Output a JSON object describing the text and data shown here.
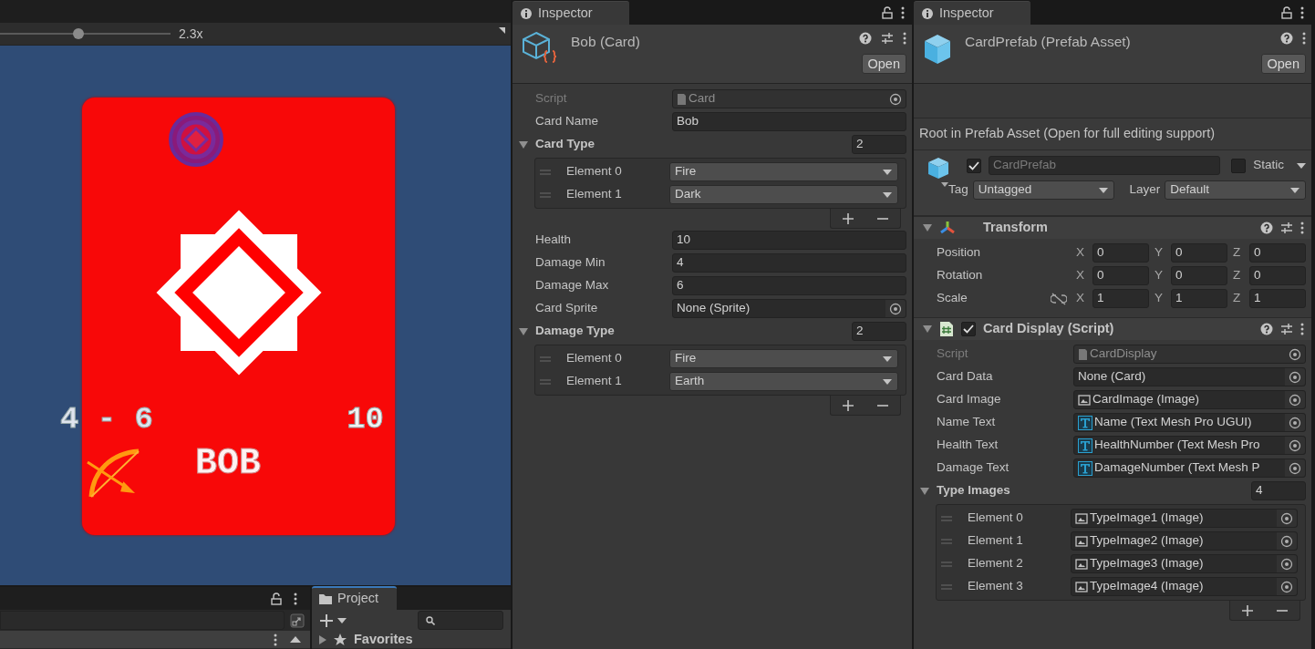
{
  "game_view": {
    "zoom": {
      "level": 0.46,
      "reading": "2.3x"
    },
    "card": {
      "damage": "4 - 6",
      "health": "10",
      "name": "BOB"
    }
  },
  "bottom_panel": {
    "project_tab": {
      "label": "Project",
      "selected": true
    },
    "favorites": {
      "label": "Favorites",
      "expanded": false
    }
  },
  "inspectors": [
    {
      "kind": "asset",
      "tab": {
        "label": "Inspector",
        "selected": true
      },
      "title": "Bob (Card)",
      "open_button": "Open",
      "fields": [
        {
          "kind": "script",
          "label": "Script",
          "value": "Card"
        },
        {
          "kind": "text",
          "label": "Card Name",
          "value": "Bob"
        },
        {
          "kind": "array",
          "label": "Card Type",
          "count": "2",
          "expanded": true,
          "elements": [
            {
              "kind": "enum",
              "label": "Element 0",
              "value": "Fire"
            },
            {
              "kind": "enum",
              "label": "Element 1",
              "value": "Dark"
            }
          ]
        },
        {
          "kind": "text",
          "label": "Health",
          "value": "10"
        },
        {
          "kind": "text",
          "label": "Damage Min",
          "value": "4"
        },
        {
          "kind": "text",
          "label": "Damage Max",
          "value": "6"
        },
        {
          "kind": "object",
          "label": "Card Sprite",
          "value": "None (Sprite)"
        },
        {
          "kind": "array",
          "label": "Damage Type",
          "count": "2",
          "expanded": true,
          "elements": [
            {
              "kind": "enum",
              "label": "Element 0",
              "value": "Fire"
            },
            {
              "kind": "enum",
              "label": "Element 1",
              "value": "Earth"
            }
          ]
        }
      ]
    },
    {
      "kind": "prefab",
      "tab": {
        "label": "Inspector",
        "selected": true
      },
      "title": "CardPrefab (Prefab Asset)",
      "open_button": "Open",
      "note": "Root in Prefab Asset (Open for full editing support)",
      "game_object": {
        "active": true,
        "name": "CardPrefab",
        "static": false,
        "static_label": "Static",
        "tag_label": "Tag",
        "tag": "Untagged",
        "layer_label": "Layer",
        "layer": "Default"
      },
      "components": [
        {
          "kind": "transform",
          "title": "Transform",
          "expanded": true,
          "rows": [
            {
              "label": "Position",
              "axes": [
                {
                  "axis": "X",
                  "value": "0"
                },
                {
                  "axis": "Y",
                  "value": "0"
                },
                {
                  "axis": "Z",
                  "value": "0"
                }
              ]
            },
            {
              "label": "Rotation",
              "axes": [
                {
                  "axis": "X",
                  "value": "0"
                },
                {
                  "axis": "Y",
                  "value": "0"
                },
                {
                  "axis": "Z",
                  "value": "0"
                }
              ]
            },
            {
              "label": "Scale",
              "constrained": false,
              "axes": [
                {
                  "axis": "X",
                  "value": "1"
                },
                {
                  "axis": "Y",
                  "value": "1"
                },
                {
                  "axis": "Z",
                  "value": "1"
                }
              ]
            }
          ]
        },
        {
          "kind": "script",
          "title": "Card Display (Script)",
          "enabled": true,
          "expanded": true,
          "fields": [
            {
              "kind": "script",
              "label": "Script",
              "value": "CardDisplay"
            },
            {
              "kind": "object",
              "label": "Card Data",
              "value": "None (Card)"
            },
            {
              "kind": "image_ref",
              "label": "Card Image",
              "value": "CardImage (Image)"
            },
            {
              "kind": "text_ref",
              "label": "Name Text",
              "value": "Name (Text Mesh Pro UGUI)"
            },
            {
              "kind": "text_ref",
              "label": "Health Text",
              "value": "HealthNumber (Text Mesh Pro"
            },
            {
              "kind": "text_ref",
              "label": "Damage Text",
              "value": "DamageNumber (Text Mesh P"
            },
            {
              "kind": "array",
              "label": "Type Images",
              "count": "4",
              "expanded": true,
              "elements": [
                {
                  "kind": "image_ref",
                  "label": "Element 0",
                  "value": "TypeImage1 (Image)"
                },
                {
                  "kind": "image_ref",
                  "label": "Element 1",
                  "value": "TypeImage2 (Image)"
                },
                {
                  "kind": "image_ref",
                  "label": "Element 2",
                  "value": "TypeImage3 (Image)"
                },
                {
                  "kind": "image_ref",
                  "label": "Element 3",
                  "value": "TypeImage4 (Image)"
                }
              ]
            }
          ]
        }
      ]
    }
  ]
}
